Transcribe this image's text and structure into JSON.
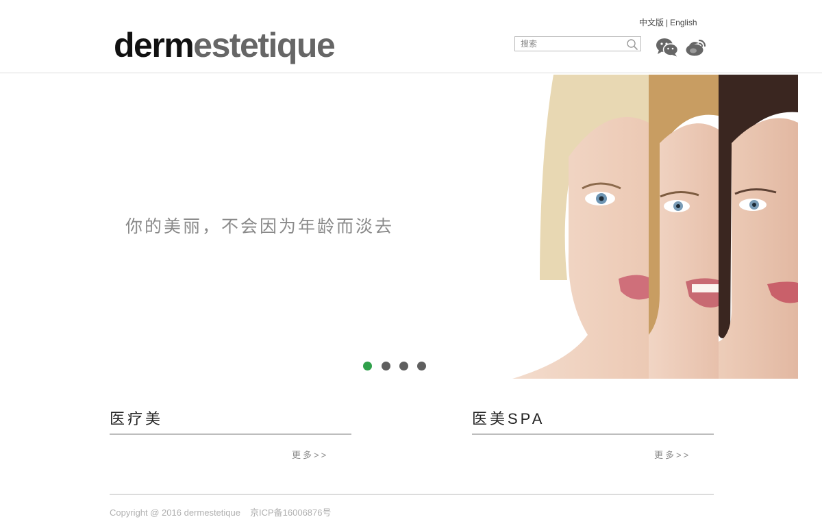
{
  "header": {
    "logo_dark": "derm",
    "logo_light": "estetique",
    "lang": {
      "zh": "中文版",
      "separator": "|",
      "en": "English"
    },
    "search": {
      "placeholder": "搜索",
      "value": ""
    },
    "social": [
      "wechat-icon",
      "weibo-icon"
    ]
  },
  "hero": {
    "slogan": "你的美丽，不会因为年龄而淡去",
    "slides": [
      {
        "active": true
      },
      {
        "active": false
      },
      {
        "active": false
      },
      {
        "active": false
      }
    ],
    "colors": {
      "active_dot": "#2fa04a",
      "inactive_dot": "#5f5f5f"
    }
  },
  "sections": [
    {
      "title": "医疗美",
      "more": "更多>>"
    },
    {
      "title": "医美SPA",
      "more": "更多>>"
    }
  ],
  "footer": {
    "copyright": "Copyright @ 2016 dermestetique",
    "icp": "京ICP备16006876号"
  }
}
